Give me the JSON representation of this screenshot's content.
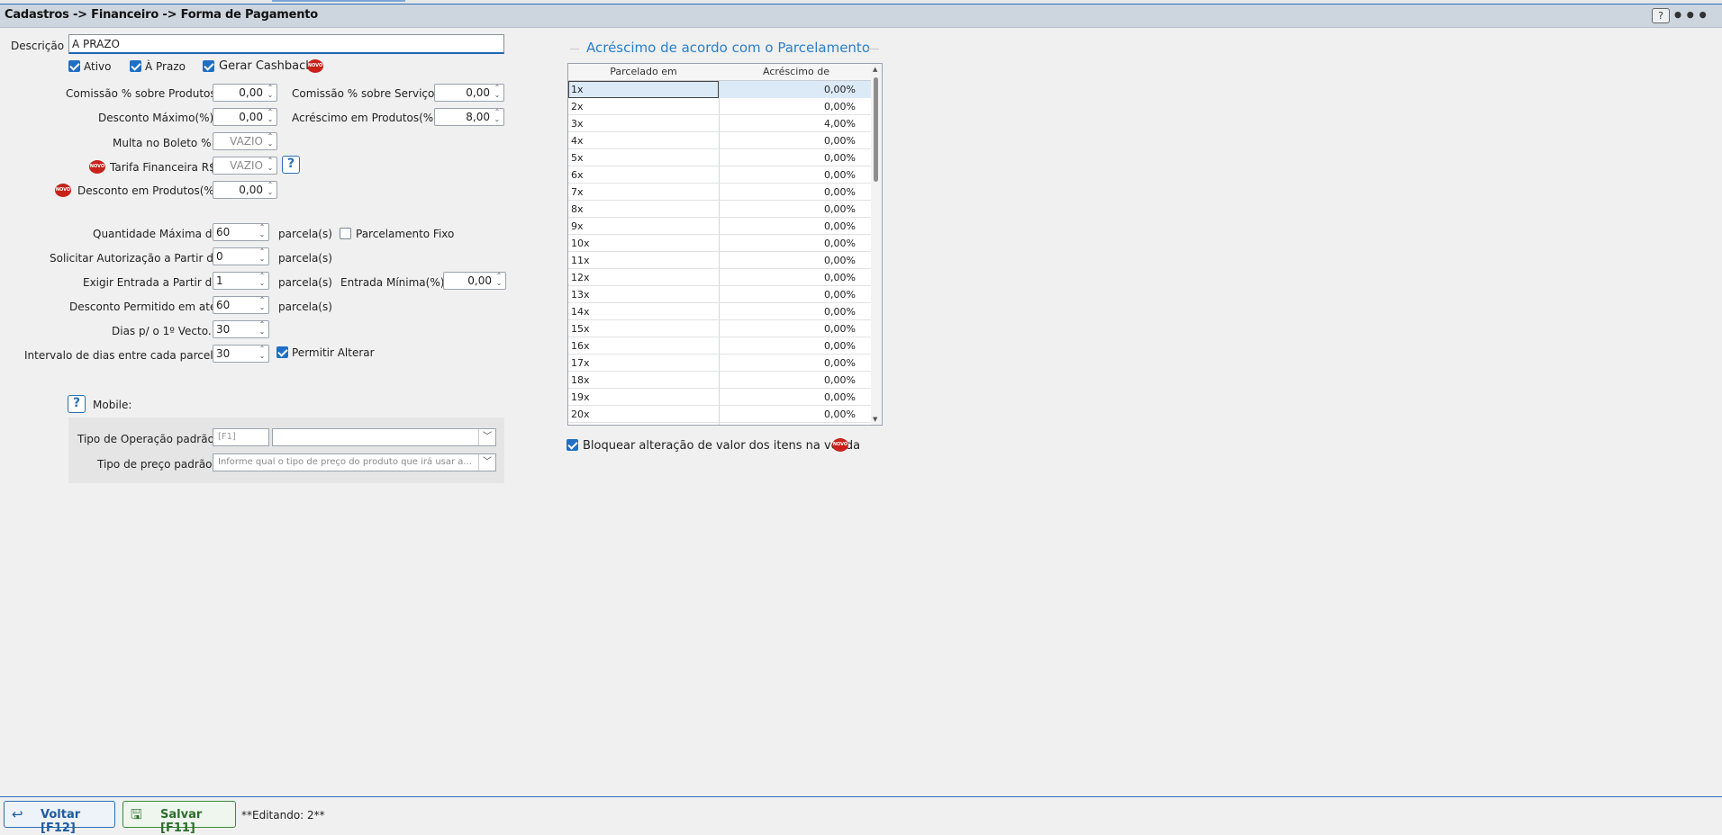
{
  "breadcrumb": "Cadastros -> Financeiro -> Forma de Pagamento",
  "header": {
    "help_label": "?",
    "more_label": "•••"
  },
  "descricao": {
    "label": "Descrição",
    "value": "A PRAZO"
  },
  "checks": {
    "ativo": "Ativo",
    "a_prazo": "À Prazo",
    "gerar_cashback": "Gerar Cashback"
  },
  "fields": {
    "comissao_produtos": {
      "label": "Comissão % sobre Produtos",
      "value": "0,00"
    },
    "comissao_servicos": {
      "label": "Comissão % sobre Serviços",
      "value": "0,00"
    },
    "desconto_maximo": {
      "label": "Desconto Máximo(%)",
      "value": "0,00"
    },
    "acrescimo_produtos": {
      "label": "Acréscimo em Produtos(%)",
      "value": "8,00"
    },
    "multa_boleto": {
      "label": "Multa no Boleto %",
      "value": "VAZIO"
    },
    "tarifa_financeira": {
      "label": "Tarifa Financeira R$",
      "value": "VAZIO"
    },
    "desconto_produtos": {
      "label": "Desconto em Produtos(%)",
      "value": "0,00"
    }
  },
  "parcelas": {
    "unit": "parcela(s)",
    "quantidade_maxima": {
      "label": "Quantidade Máxima de",
      "value": "60"
    },
    "parcelamento_fixo": "Parcelamento Fixo",
    "solicitar_autorizacao": {
      "label": "Solicitar Autorização a Partir de",
      "value": "0"
    },
    "exigir_entrada": {
      "label": "Exigir Entrada a Partir de",
      "value": "1"
    },
    "entrada_minima": {
      "label": "Entrada Mínima(%)",
      "value": "0,00"
    },
    "desconto_permitido": {
      "label": "Desconto Permitido em até",
      "value": "60"
    },
    "dias_primeiro_vecto": {
      "label": "Dias p/ o 1º Vecto.",
      "value": "30"
    },
    "intervalo_dias": {
      "label": "Intervalo de dias entre cada parcelas",
      "value": "30"
    },
    "permitir_alterar": "Permitir Alterar"
  },
  "mobile": {
    "title": "Mobile:",
    "tipo_operacao": {
      "label": "Tipo de Operação padrão",
      "code_placeholder": "[F1]",
      "value": ""
    },
    "tipo_preco": {
      "label": "Tipo de preço padrão",
      "placeholder": "Informe qual o tipo de preço do produto que irá usar a..."
    }
  },
  "badge_text": "NOVO",
  "acrescimo_section": {
    "title": "Acréscimo de acordo com o Parcelamento",
    "columns": [
      "Parcelado em",
      "Acréscimo de"
    ],
    "rows": [
      [
        "1x",
        "0,00%"
      ],
      [
        "2x",
        "0,00%"
      ],
      [
        "3x",
        "4,00%"
      ],
      [
        "4x",
        "0,00%"
      ],
      [
        "5x",
        "0,00%"
      ],
      [
        "6x",
        "0,00%"
      ],
      [
        "7x",
        "0,00%"
      ],
      [
        "8x",
        "0,00%"
      ],
      [
        "9x",
        "0,00%"
      ],
      [
        "10x",
        "0,00%"
      ],
      [
        "11x",
        "0,00%"
      ],
      [
        "12x",
        "0,00%"
      ],
      [
        "13x",
        "0,00%"
      ],
      [
        "14x",
        "0,00%"
      ],
      [
        "15x",
        "0,00%"
      ],
      [
        "16x",
        "0,00%"
      ],
      [
        "17x",
        "0,00%"
      ],
      [
        "18x",
        "0,00%"
      ],
      [
        "19x",
        "0,00%"
      ],
      [
        "20x",
        "0,00%"
      ]
    ],
    "bloquear_alteracao": "Bloquear alteração de valor dos itens na venda"
  },
  "footer": {
    "voltar": "Voltar [F12]",
    "salvar": "Salvar [F11]",
    "status": "**Editando: 2**"
  },
  "colors": {
    "accent": "#2a6fb5",
    "title_blue": "#2a7fc9",
    "save_green": "#2a6e2a",
    "badge_red": "#c8221a"
  }
}
